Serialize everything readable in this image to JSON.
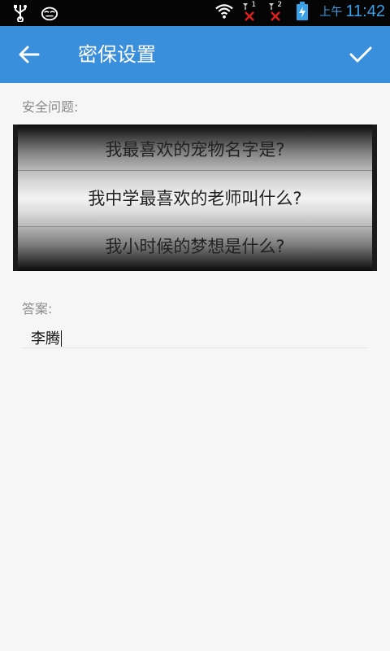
{
  "status_bar": {
    "icons": [
      "usb-icon",
      "cat-icon",
      "wifi-icon",
      "signal-1-icon",
      "signal-2-icon",
      "battery-charging-icon"
    ],
    "sim1_label": "1",
    "sim2_label": "2",
    "ampm": "上午",
    "time": "11:42"
  },
  "app_bar": {
    "back_icon": "arrow-left-icon",
    "title": "密保设置",
    "confirm_icon": "check-icon"
  },
  "question": {
    "label": "安全问题:",
    "options": [
      "我最喜欢的宠物名字是?",
      "我中学最喜欢的老师叫什么?",
      "我小时候的梦想是什么?"
    ],
    "selected_index": 1
  },
  "answer": {
    "label": "答案:",
    "value": "李腾"
  },
  "colors": {
    "app_bar": "#3a8fdd",
    "status_time": "#3aa0e8",
    "background": "#f6f6f6"
  }
}
